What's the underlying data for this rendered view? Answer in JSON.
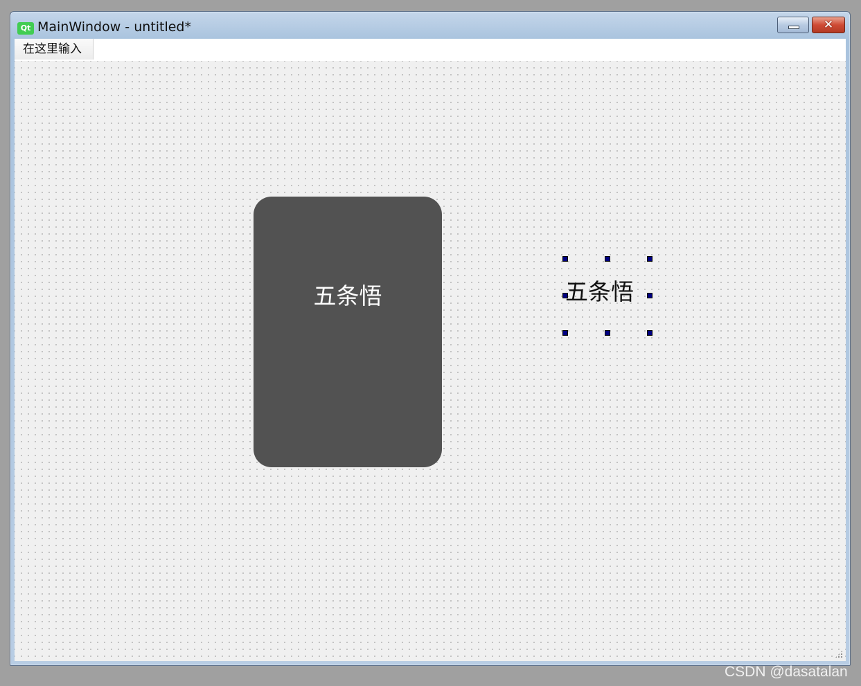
{
  "window": {
    "title": "MainWindow - untitled*",
    "icon": "qt-logo-icon",
    "icon_text": "Qt",
    "minimize_glyph": "",
    "close_glyph": "✕"
  },
  "menubar": {
    "placeholder_item": "在这里输入"
  },
  "canvas": {
    "card_label": "五条悟",
    "selected_label": "五条悟"
  },
  "colors": {
    "card_background": "#525252",
    "card_text": "#ffffff",
    "selection_handle": "#000080",
    "qt_green": "#41cd52"
  },
  "watermark": "CSDN @dasatalan"
}
